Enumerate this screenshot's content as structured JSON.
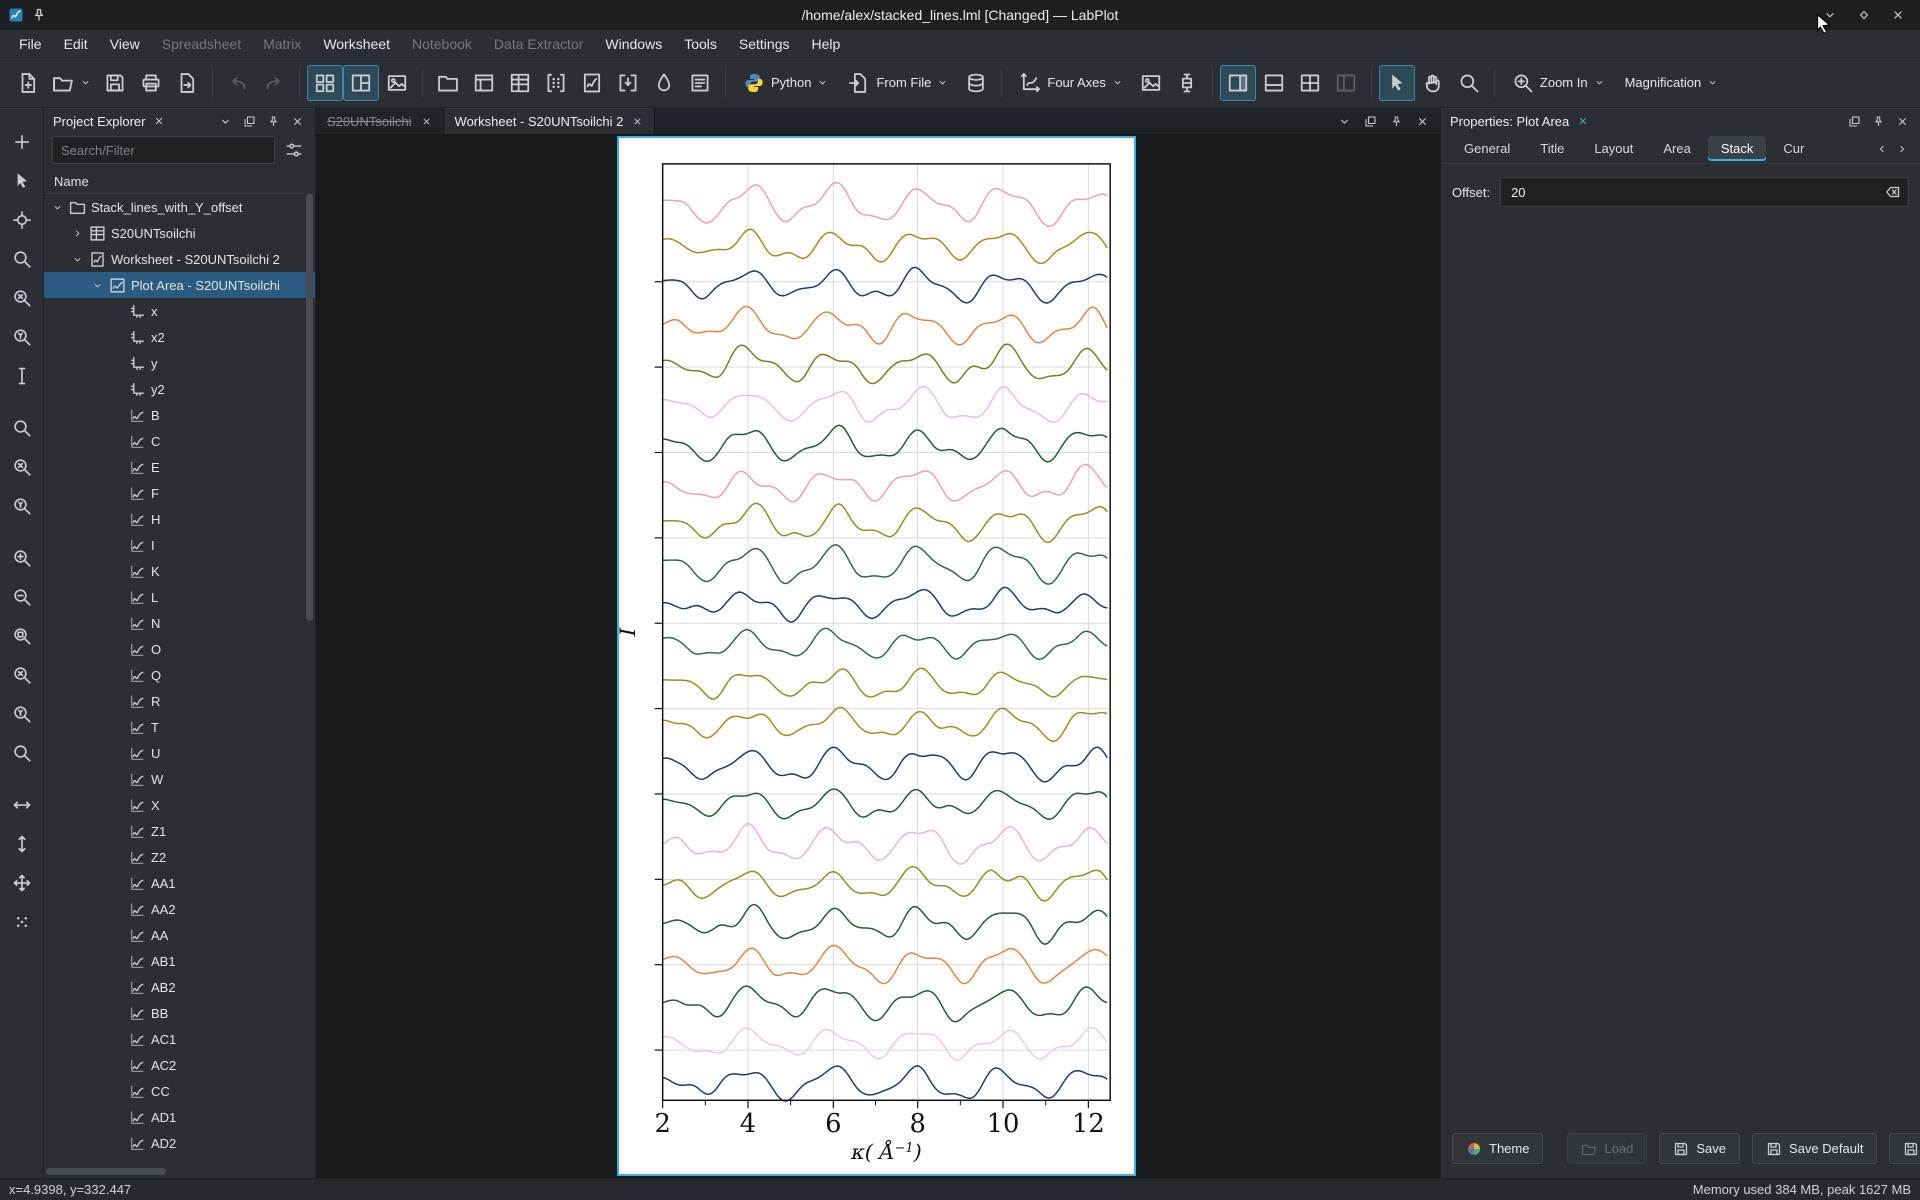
{
  "window": {
    "title": "/home/alex/stacked_lines.lml [Changed] — LabPlot",
    "app_icons": [
      {
        "name": "app-icon",
        "icon": "app"
      },
      {
        "name": "pin-title-icon",
        "icon": "pin"
      }
    ],
    "controls": [
      {
        "name": "minimize-button",
        "icon": "chevron-down"
      },
      {
        "name": "maximize-button",
        "icon": "diamond"
      },
      {
        "name": "close-button",
        "icon": "close"
      }
    ]
  },
  "menu_bar": {
    "items": [
      {
        "label": "File",
        "enabled": true
      },
      {
        "label": "Edit",
        "enabled": true
      },
      {
        "label": "View",
        "enabled": true
      },
      {
        "label": "Spreadsheet",
        "enabled": false
      },
      {
        "label": "Matrix",
        "enabled": false
      },
      {
        "label": "Worksheet",
        "enabled": true
      },
      {
        "label": "Notebook",
        "enabled": false
      },
      {
        "label": "Data Extractor",
        "enabled": false
      },
      {
        "label": "Windows",
        "enabled": true
      },
      {
        "label": "Tools",
        "enabled": true
      },
      {
        "label": "Settings",
        "enabled": true
      },
      {
        "label": "Help",
        "enabled": true
      }
    ]
  },
  "toolbar": {
    "groups": [
      [
        {
          "name": "new-project-button",
          "icon": "new-file"
        },
        {
          "name": "open-project-button",
          "icon": "folder-open",
          "chevron": true
        },
        {
          "name": "save-project-button",
          "icon": "save"
        },
        {
          "name": "print-button",
          "icon": "print"
        },
        {
          "name": "print-preview-button",
          "icon": "export-file"
        }
      ],
      [
        {
          "name": "undo-button",
          "icon": "undo",
          "disabled": true
        },
        {
          "name": "redo-button",
          "icon": "redo",
          "disabled": true
        }
      ],
      [
        {
          "name": "tile-windows-button",
          "icon": "grid-quad",
          "active": true
        },
        {
          "name": "split-windows-button",
          "icon": "grid-split",
          "active": true
        },
        {
          "name": "export-image-button",
          "icon": "image"
        }
      ],
      [
        {
          "name": "new-folder-button",
          "icon": "folder"
        },
        {
          "name": "new-workbook-button",
          "icon": "workbook"
        },
        {
          "name": "new-spreadsheet-button",
          "icon": "spreadsheet"
        },
        {
          "name": "new-matrix-button",
          "icon": "matrix"
        },
        {
          "name": "new-worksheet-button",
          "icon": "worksheet"
        },
        {
          "name": "new-live-data-button",
          "icon": "live-data"
        },
        {
          "name": "data-picker-button",
          "icon": "drop"
        },
        {
          "name": "new-note-button",
          "icon": "note"
        }
      ],
      [
        {
          "name": "new-notebook-python-button",
          "icon": "python",
          "label": "Python",
          "chevron": true
        },
        {
          "name": "import-from-file-button",
          "icon": "import-file",
          "label": "From File",
          "chevron": true
        },
        {
          "name": "import-sql-button",
          "icon": "database"
        }
      ],
      [
        {
          "name": "add-plot-four-axes-button",
          "icon": "axes",
          "label": "Four Axes",
          "chevron": true
        },
        {
          "name": "add-image-button",
          "icon": "image"
        },
        {
          "name": "add-boxplot-button",
          "icon": "boxplot"
        }
      ],
      [
        {
          "name": "dock-layout-right-button",
          "icon": "dock-right",
          "active": true
        },
        {
          "name": "dock-layout-bottom-button",
          "icon": "dock-bottom"
        },
        {
          "name": "dock-layout-grid-button",
          "icon": "dock-grid"
        },
        {
          "name": "dock-layout-left-button",
          "icon": "dock-left",
          "disabled": true
        }
      ],
      [
        {
          "name": "select-mode-button",
          "icon": "cursor",
          "active": true
        },
        {
          "name": "pan-mode-button",
          "icon": "hand"
        },
        {
          "name": "zoom-mode-button",
          "icon": "zoom-select"
        }
      ],
      [
        {
          "name": "zoom-in-button",
          "icon": "zoom-in",
          "label": "Zoom In",
          "chevron": true
        },
        {
          "name": "magnification-button",
          "label": "Magnification",
          "chevron": true
        }
      ]
    ]
  },
  "left_toolbar": {
    "groups": [
      [
        {
          "name": "add-plot-tool",
          "icon": "plus"
        },
        {
          "name": "select-tool",
          "icon": "cursor"
        },
        {
          "name": "crosshair-tool",
          "icon": "crosshair"
        },
        {
          "name": "zoom-select-tool",
          "icon": "zoom-select"
        },
        {
          "name": "zoom-x-select-tool",
          "icon": "zoom-x"
        },
        {
          "name": "zoom-y-select-tool",
          "icon": "zoom-y"
        },
        {
          "name": "cursor-tool",
          "icon": "cursor-line"
        }
      ],
      [
        {
          "name": "zoom-region-tool",
          "icon": "zoom-select"
        },
        {
          "name": "zoom-x-region-tool",
          "icon": "zoom-x"
        },
        {
          "name": "zoom-y-region-tool",
          "icon": "zoom-y"
        }
      ],
      [
        {
          "name": "zoom-in-tool",
          "icon": "zoom-in"
        },
        {
          "name": "zoom-out-tool",
          "icon": "zoom-out"
        },
        {
          "name": "zoom-original-tool",
          "icon": "zoom-fit"
        },
        {
          "name": "zoom-fit-x-tool",
          "icon": "zoom-x"
        },
        {
          "name": "zoom-fit-y-tool",
          "icon": "zoom-y"
        },
        {
          "name": "zoom-fit-tool",
          "icon": "zoom-select"
        }
      ],
      [
        {
          "name": "shift-horizontal-tool",
          "icon": "shift-h"
        },
        {
          "name": "shift-vertical-tool",
          "icon": "shift-v"
        },
        {
          "name": "move-tool",
          "icon": "move"
        },
        {
          "name": "more-tools",
          "icon": "dots"
        }
      ]
    ]
  },
  "project_explorer": {
    "title": "Project Explorer",
    "search_placeholder": "Search/Filter",
    "column_header": "Name",
    "header_icons": [
      "chevron-down",
      "float",
      "pin",
      "close"
    ],
    "tree": [
      {
        "label": "Stack_lines_with_Y_offset",
        "icon": "folder",
        "level": 0,
        "arrow": "down"
      },
      {
        "label": "S20UNTsoilchi",
        "icon": "spreadsheet",
        "level": 1,
        "arrow": "right"
      },
      {
        "label": "Worksheet - S20UNTsoilchi 2",
        "icon": "worksheet",
        "level": 1,
        "arrow": "down"
      },
      {
        "label": "Plot Area - S20UNTsoilchi",
        "icon": "plot-area",
        "level": 2,
        "arrow": "down",
        "selected": true
      },
      {
        "label": "x",
        "icon": "axis",
        "level": 3
      },
      {
        "label": "x2",
        "icon": "axis",
        "level": 3
      },
      {
        "label": "y",
        "icon": "axis",
        "level": 3
      },
      {
        "label": "y2",
        "icon": "axis",
        "level": 3
      },
      {
        "label": "B",
        "icon": "curve",
        "level": 3
      },
      {
        "label": "C",
        "icon": "curve",
        "level": 3
      },
      {
        "label": "E",
        "icon": "curve",
        "level": 3
      },
      {
        "label": "F",
        "icon": "curve",
        "level": 3
      },
      {
        "label": "H",
        "icon": "curve",
        "level": 3
      },
      {
        "label": "I",
        "icon": "curve",
        "level": 3
      },
      {
        "label": "K",
        "icon": "curve",
        "level": 3
      },
      {
        "label": "L",
        "icon": "curve",
        "level": 3
      },
      {
        "label": "N",
        "icon": "curve",
        "level": 3
      },
      {
        "label": "O",
        "icon": "curve",
        "level": 3
      },
      {
        "label": "Q",
        "icon": "curve",
        "level": 3
      },
      {
        "label": "R",
        "icon": "curve",
        "level": 3
      },
      {
        "label": "T",
        "icon": "curve",
        "level": 3
      },
      {
        "label": "U",
        "icon": "curve",
        "level": 3
      },
      {
        "label": "W",
        "icon": "curve",
        "level": 3
      },
      {
        "label": "X",
        "icon": "curve",
        "level": 3
      },
      {
        "label": "Z1",
        "icon": "curve",
        "level": 3
      },
      {
        "label": "Z2",
        "icon": "curve",
        "level": 3
      },
      {
        "label": "AA1",
        "icon": "curve",
        "level": 3
      },
      {
        "label": "AA2",
        "icon": "curve",
        "level": 3
      },
      {
        "label": "AA",
        "icon": "curve",
        "level": 3
      },
      {
        "label": "AB1",
        "icon": "curve",
        "level": 3
      },
      {
        "label": "AB2",
        "icon": "curve",
        "level": 3
      },
      {
        "label": "BB",
        "icon": "curve",
        "level": 3
      },
      {
        "label": "AC1",
        "icon": "curve",
        "level": 3
      },
      {
        "label": "AC2",
        "icon": "curve",
        "level": 3
      },
      {
        "label": "CC",
        "icon": "curve",
        "level": 3
      },
      {
        "label": "AD1",
        "icon": "curve",
        "level": 3
      },
      {
        "label": "AD2",
        "icon": "curve",
        "level": 3
      }
    ]
  },
  "center": {
    "tabs": [
      {
        "label": "S20UNTsoilchi",
        "active": false,
        "strikethrough": true
      },
      {
        "label": "Worksheet - S20UNTsoilchi 2",
        "active": true
      }
    ],
    "tabbar_icons": [
      "chevron-down",
      "float",
      "pin",
      "close"
    ]
  },
  "plot": {
    "type": "line",
    "x_ticks": [
      "2",
      "4",
      "6",
      "8",
      "10",
      "12"
    ],
    "xlabel": {
      "prefix": "κ( Å",
      "sup": "−1",
      "suffix": ")"
    },
    "ylabel": "I",
    "offset": 20,
    "curves": [
      {
        "name": "B",
        "color": "#ef9fb0"
      },
      {
        "name": "C",
        "color": "#a8891f"
      },
      {
        "name": "E",
        "color": "#1d3c6e"
      },
      {
        "name": "F",
        "color": "#e08448"
      },
      {
        "name": "H",
        "color": "#7c7c1f"
      },
      {
        "name": "I",
        "color": "#f0b8ea"
      },
      {
        "name": "K",
        "color": "#1f5c38"
      },
      {
        "name": "L",
        "color": "#ef9fb0"
      },
      {
        "name": "N",
        "color": "#8f8f22"
      },
      {
        "name": "O",
        "color": "#2b6a4c"
      },
      {
        "name": "Q",
        "color": "#1d3c6e"
      },
      {
        "name": "R",
        "color": "#2b6a55"
      },
      {
        "name": "T",
        "color": "#8f8f22"
      },
      {
        "name": "U",
        "color": "#a8891f"
      },
      {
        "name": "W",
        "color": "#1d3c6e"
      },
      {
        "name": "X",
        "color": "#1f5c38"
      },
      {
        "name": "Z1",
        "color": "#e8b2e2"
      },
      {
        "name": "Z2",
        "color": "#8f8f22"
      },
      {
        "name": "AA1",
        "color": "#1f5c38"
      },
      {
        "name": "AA2",
        "color": "#e08448"
      },
      {
        "name": "AA",
        "color": "#1f5c38"
      },
      {
        "name": "AB1",
        "color": "#eec6ee"
      },
      {
        "name": "AB2",
        "color": "#1d3c6e"
      }
    ]
  },
  "properties": {
    "title": "Properties: Plot Area",
    "header_icons": [
      "float",
      "pin",
      "close"
    ],
    "tabs": [
      {
        "label": "General"
      },
      {
        "label": "Title"
      },
      {
        "label": "Layout"
      },
      {
        "label": "Area"
      },
      {
        "label": "Stack",
        "active": true
      },
      {
        "label": "Cur",
        "clipped": true
      }
    ],
    "offset_label": "Offset:",
    "offset_value": "20",
    "footer_buttons": [
      {
        "name": "theme-button",
        "label": "Theme",
        "icon": "palette"
      },
      {
        "name": "load-button",
        "label": "Load",
        "icon": "folder-open",
        "disabled": true,
        "right": true
      },
      {
        "name": "save-button",
        "label": "Save",
        "icon": "save",
        "right": true
      },
      {
        "name": "save-default-button",
        "label": "Save Default",
        "icon": "save",
        "right": true
      },
      {
        "name": "save-template-button",
        "icon": "save",
        "right": true
      }
    ]
  },
  "status_bar": {
    "left": "x=4.9398, y=332.447",
    "right": "Memory used 384 MB, peak 1627 MB"
  }
}
